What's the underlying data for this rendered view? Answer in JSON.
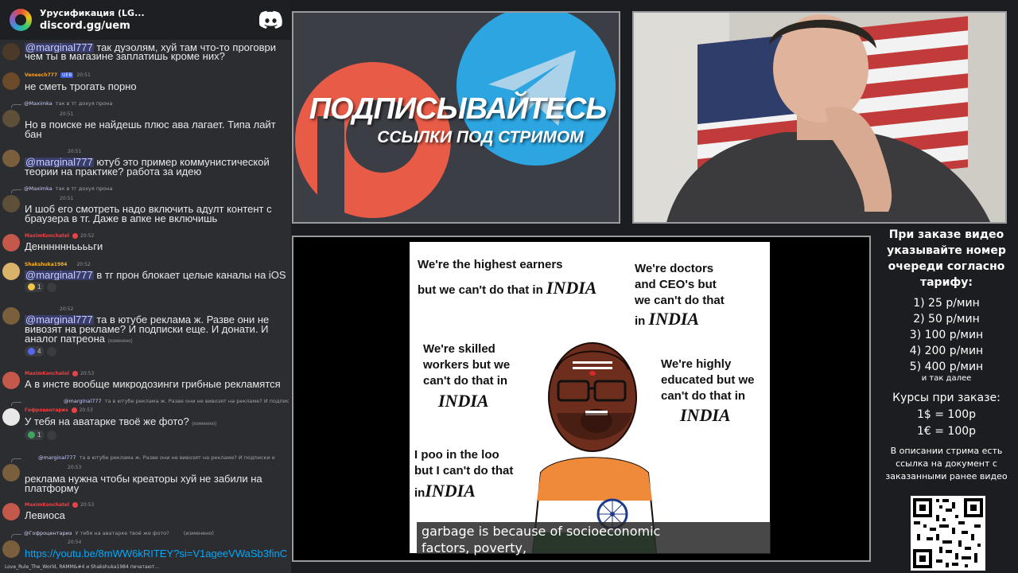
{
  "chat": {
    "server_name": "Урусификация (LG...",
    "invite": "discord.gg/uem",
    "typing": "Love_Rule_The_World, RAMM&#4 и Shakshuka1984 печатают...",
    "messages": [
      {
        "top": 0,
        "text_html_parts": [
          {
            "mention": "@marginal777"
          },
          {
            "text": " так дуэолям, хуй там что-то проговри"
          }
        ],
        "second_line": "чем ты в магазине заплатишь кроме них?",
        "avatar": "#4b3a2a"
      },
      {
        "author": "Veneech777",
        "author_color": "#e9a23b",
        "time": "20:51",
        "text": "не сметь трогать порно",
        "avatar": "#6b4a2a"
      },
      {
        "reply_author": "@Maximka",
        "reply_text": "так в тг дохуя прона",
        "time": "20:51",
        "text": "Но в поиске не найдешь плюс ава лагает. Типа лайт",
        "second_line": "бан",
        "avatar": "#5d4f38"
      },
      {
        "time": "20:51",
        "mention": "@marginal777",
        "text": " ютуб это пример коммунистической",
        "second_line": "теории на практике? работа за идею",
        "avatar": "#7a5f3c"
      },
      {
        "reply_author": "@Maximka",
        "reply_text": "так в тг дохуя прона",
        "time": "20:51",
        "text": "И шоб его смотреть надо включить адулт контент с",
        "second_line": "браузера в тг. Даже в апке не включишь",
        "avatar": "#5d4f38"
      },
      {
        "author": "MaximKonchatel",
        "author_color": "#ed4245",
        "time": "20:52",
        "text": "Деннннннььььги",
        "avatar": "#c4584a"
      },
      {
        "author": "Shakshuka1984",
        "author_color": "#f0b232",
        "time": "20:52",
        "mention": "@marginal777",
        "text": " в тг прон блокает целые каналы на iOS",
        "reaction_count": "1",
        "avatar": "#d9b36b"
      },
      {
        "time": "20:52",
        "mention": "@marginal777",
        "text": " та в ютубе реклама ж. Разве они не",
        "second_line": "вивозят на рекламе? И подписки еще. И донати. И",
        "third_line": "аналог патреона",
        "edited": "(изменено)",
        "reaction_count": "4",
        "avatar": "#7a5f3c"
      },
      {
        "author": "MaximKonchatel",
        "author_color": "#ed4245",
        "time": "20:53",
        "text": "А в инсте вообще микродозинги грибные рекламятся",
        "avatar": "#c4584a"
      },
      {
        "reply_author": "@marginal777",
        "reply_text": "та в ютубе реклама ж. Разве они не вивозят на рекламе? И подписки е",
        "author": "Гофроцентариэ",
        "author_color": "#ed4245",
        "time": "20:53",
        "text": "У тебя на аватарке твоё же фото?",
        "edited": "(изменено)",
        "reaction_count": "1",
        "avatar": "#e8e8e8"
      },
      {
        "reply_author": "@marginal777",
        "reply_text": "та в ютубе реклама ж. Разве они не вивозят на рекламе? И подписки е",
        "time": "20:53",
        "text": "реклама нужна чтобы креаторы хуй не забили на",
        "second_line": "платформу",
        "avatar": "#7a5f3c"
      },
      {
        "author": "MaximKonchatel",
        "author_color": "#ed4245",
        "time": "20:53",
        "text": "Левиоса",
        "avatar": "#c4584a"
      },
      {
        "reply_author": "@Гофроцентариэ",
        "reply_text": "У тебя на аватарке твоё же фото?",
        "edited": "(изменено)",
        "time": "20:54",
        "link": "https://youtu.be/8mWW6kRITEY?si=V1ageeVWaSb3finC",
        "avatar": "#7a5f3c"
      }
    ]
  },
  "banner": {
    "title": "ПОДПИСЫВАЙТЕСЬ",
    "subtitle": "ССЫЛКИ ПОД СТРИМОМ",
    "patreon_color": "#e85b46",
    "telegram_color": "#2ca5e0"
  },
  "video": {
    "meme": {
      "t1a": "We're the highest earners",
      "t1b": "but we can't do that in",
      "t2": "We're doctors",
      "t2b": "and CEO's but",
      "t2c": "we can't do that",
      "t2d": "in",
      "t3a": "We're skilled",
      "t3b": "workers but we",
      "t3c": "can't do that in",
      "t4a": "We're highly",
      "t4b": "educated but we",
      "t4c": "can't do that in",
      "t5a": "I poo in the loo",
      "t5b": "but I can't do that",
      "t5c": "in",
      "india": "INDIA"
    },
    "subtitle_line1": "garbage is because of socioeconomic",
    "subtitle_line2": "factors, poverty,"
  },
  "info": {
    "intro": "При заказе видео указывайте номер очереди согласно тарифу:",
    "tariffs": [
      "1) 25 р/мин",
      "2) 50 р/мин",
      "3) 100 р/мин",
      "4) 200 р/мин",
      "5) 400 р/мин"
    ],
    "more": "и так далее",
    "rates_title": "Курсы при заказе:",
    "rates": [
      "1$ = 100р",
      "1€ = 100р"
    ],
    "description": "В описании стрима есть ссылка на документ с заказанными ранее видео"
  }
}
